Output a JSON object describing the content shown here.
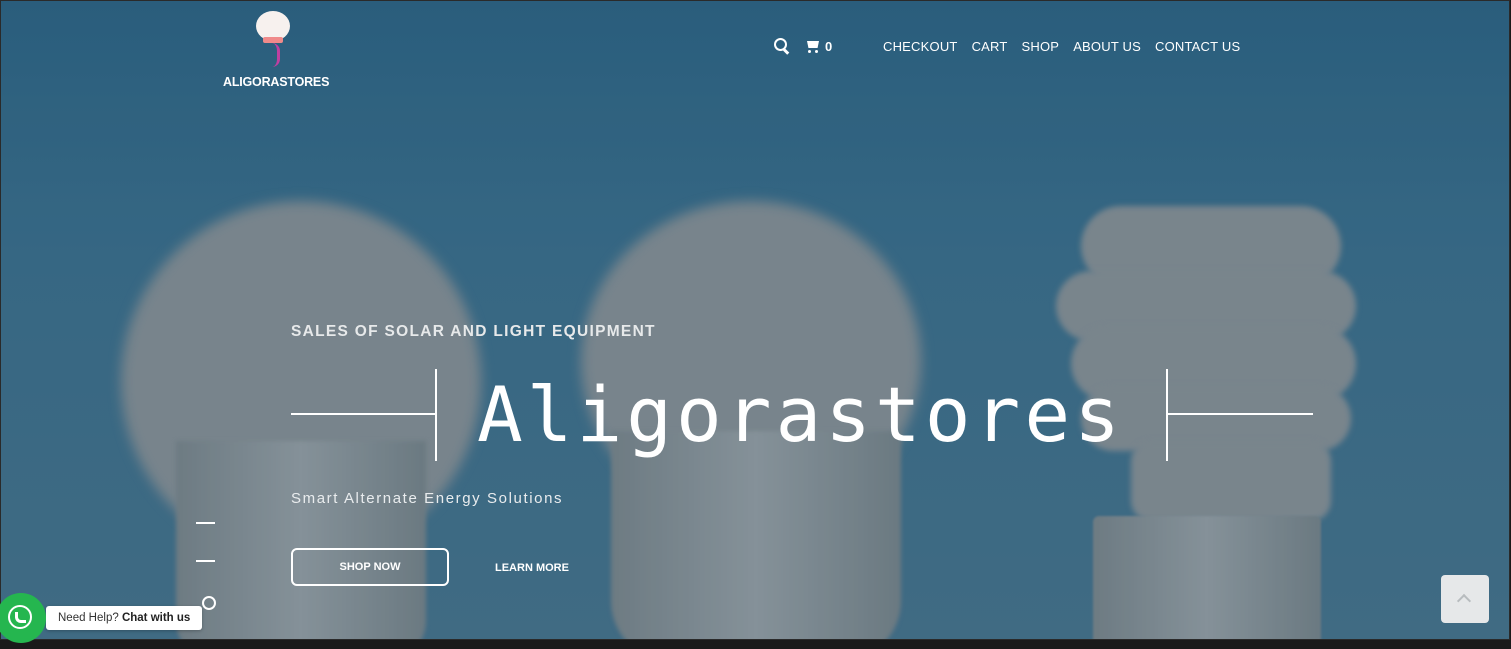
{
  "header": {
    "logo_text": "ALIGORASTORES",
    "cart_count": "0",
    "nav": [
      "CHECKOUT",
      "CART",
      "SHOP",
      "ABOUT US",
      "CONTACT US"
    ]
  },
  "hero": {
    "eyebrow": "SALES OF SOLAR AND LIGHT EQUIPMENT",
    "headline": "Aligorastores",
    "subtitle": "Smart Alternate Energy Solutions",
    "primary_button": "SHOP NOW",
    "secondary_button": "LEARN MORE",
    "slides": 3,
    "active_slide": 3
  },
  "chat_widget": {
    "prefix": "Need Help?",
    "action": "Chat with us"
  },
  "icons": {
    "search": "search-icon",
    "cart": "cart-icon",
    "whatsapp": "whatsapp-icon",
    "back_to_top": "chevron-up-icon"
  },
  "colors": {
    "hero_blue": "#2b5f7d",
    "whatsapp_green": "#25b64f",
    "text": "#ffffff"
  }
}
